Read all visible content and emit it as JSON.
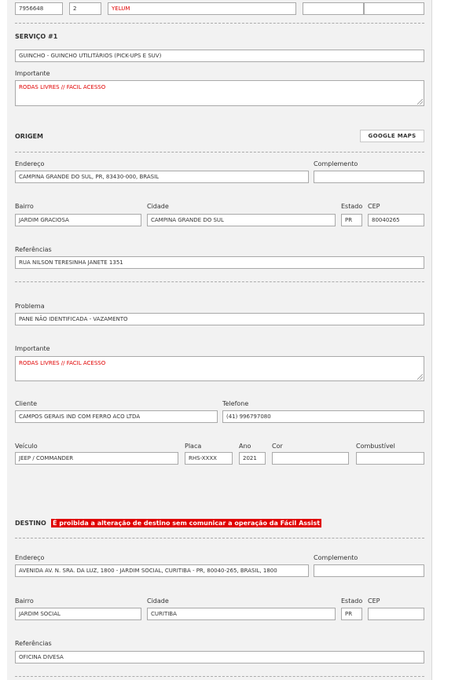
{
  "top_row": {
    "field1": "7956648",
    "field2": "2",
    "field3": "YELUM",
    "field4": "",
    "field5": ""
  },
  "servico": {
    "title": "SERVIÇO #1",
    "tipo": "GUINCHO - GUINCHO UTILITÁRIOS (PICK-UPS E SUV)",
    "importante_label": "Importante",
    "importante": "RODAS LIVRES // FACIL ACESSO"
  },
  "origem": {
    "title": "ORIGEM",
    "maps_button": "GOOGLE MAPS",
    "endereco_label": "Endereço",
    "endereco": "CAMPINA GRANDE DO SUL, PR, 83430-000, BRASIL",
    "complemento_label": "Complemento",
    "complemento": "",
    "bairro_label": "Bairro",
    "bairro": "JARDIM GRACIOSA",
    "cidade_label": "Cidade",
    "cidade": "CAMPINA GRANDE DO SUL",
    "estado_label": "Estado",
    "estado": "PR",
    "cep_label": "CEP",
    "cep": "80040265",
    "referencias_label": "Referências",
    "referencias": "RUA NILSON TERESINHA JANETE 1351"
  },
  "problema": {
    "problema_label": "Problema",
    "problema": "PANE NÃO IDENTIFICADA - VAZAMENTO",
    "importante_label": "Importante",
    "importante": "RODAS LIVRES // FACIL ACESSO",
    "cliente_label": "Cliente",
    "cliente": "CAMPOS GERAIS IND COM FERRO ACO LTDA",
    "telefone_label": "Telefone",
    "telefone": "(41) 996797080",
    "veiculo_label": "Veículo",
    "veiculo": "JEEP / COMMANDER",
    "placa_label": "Placa",
    "placa": "RHS-XXXX",
    "ano_label": "Ano",
    "ano": "2021",
    "cor_label": "Cor",
    "cor": "",
    "combustivel_label": "Combustível",
    "combustivel": ""
  },
  "destino": {
    "title": "DESTINO",
    "warning": "É proibida a alteração de destino sem comunicar a operação da Fácil Assist",
    "endereco_label": "Endereço",
    "endereco": "AVENIDA AV. N. SRA. DA LUZ, 1800 - JARDIM SOCIAL, CURITIBA - PR, 80040-265, BRASIL, 1800",
    "complemento_label": "Complemento",
    "complemento": "",
    "bairro_label": "Bairro",
    "bairro": "JARDIM SOCIAL",
    "cidade_label": "Cidade",
    "cidade": "CURITIBA",
    "estado_label": "Estado",
    "estado": "PR",
    "cep_label": "CEP",
    "cep": "",
    "referencias_label": "Referências",
    "referencias": "OFICINA DIVESA"
  }
}
